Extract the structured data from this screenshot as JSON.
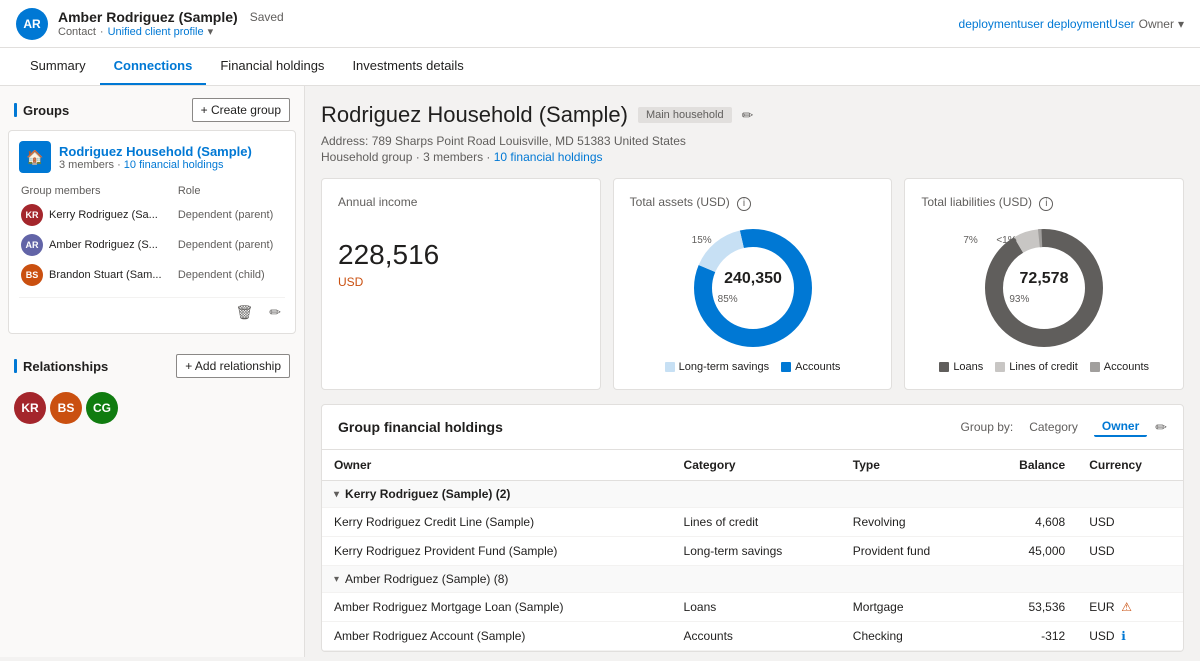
{
  "header": {
    "avatar_initials": "AR",
    "name": "Amber Rodriguez (Sample)",
    "saved_label": "Saved",
    "contact_label": "Contact",
    "profile_label": "Unified client profile",
    "user_label": "deploymentuser deploymentUser",
    "owner_label": "Owner"
  },
  "nav": {
    "tabs": [
      {
        "label": "Summary",
        "active": false
      },
      {
        "label": "Connections",
        "active": true
      },
      {
        "label": "Financial holdings",
        "active": false
      },
      {
        "label": "Investments details",
        "active": false
      }
    ]
  },
  "left_panel": {
    "groups_title": "Groups",
    "create_group_label": "+ Create group",
    "group": {
      "name": "Rodriguez Household (Sample)",
      "meta": "3 members · 10 financial holdings",
      "members_col": "Group members",
      "role_col": "Role",
      "members": [
        {
          "initials": "KR",
          "name": "Kerry Rodriguez (Sa...",
          "role": "Dependent (parent)",
          "color": "#a4262c"
        },
        {
          "initials": "AR",
          "name": "Amber Rodriguez (S...",
          "role": "Dependent (parent)",
          "color": "#6264a7"
        },
        {
          "initials": "BS",
          "name": "Brandon Stuart (Sam...",
          "role": "Dependent (child)",
          "color": "#ca5010"
        }
      ]
    },
    "relationships_title": "Relationships",
    "add_relationship_label": "+ Add relationship",
    "relationship_avatars": [
      {
        "initials": "KR",
        "color": "#a4262c"
      },
      {
        "initials": "BS",
        "color": "#ca5010"
      },
      {
        "initials": "CG",
        "color": "#107c10"
      }
    ]
  },
  "main": {
    "household_title": "Rodriguez Household (Sample)",
    "main_household_badge": "Main household",
    "address": "Address: 789 Sharps Point Road Louisville, MD 51383 United States",
    "household_group": "Household group",
    "members_count": "3 members",
    "financial_holdings_count": "10 financial holdings",
    "annual_income": {
      "title": "Annual income",
      "value": "228,516",
      "currency": "USD"
    },
    "total_assets": {
      "title": "Total assets (USD)",
      "value": "240,350",
      "segments": [
        {
          "label": "Long-term savings",
          "percent": 15,
          "color": "#c7e0f4"
        },
        {
          "label": "Accounts",
          "percent": 85,
          "color": "#0078d4"
        }
      ],
      "legend_long_term": "Long-term savings",
      "legend_accounts": "Accounts",
      "percent_top": "15%",
      "percent_bottom": "85%"
    },
    "total_liabilities": {
      "title": "Total liabilities (USD)",
      "value": "72,578",
      "segments": [
        {
          "label": "Loans",
          "percent": 93,
          "color": "#605e5c"
        },
        {
          "label": "Lines of credit",
          "percent": 7,
          "color": "#c8c6c4"
        },
        {
          "label": "Accounts",
          "percent": 1,
          "color": "#a19f9d"
        }
      ],
      "legend_loans": "Loans",
      "legend_lines": "Lines of credit",
      "legend_accounts": "Accounts",
      "percent_top_left": "7%",
      "percent_top_right": "<1%",
      "percent_bottom": "93%"
    },
    "holdings": {
      "title": "Group financial holdings",
      "groupby_label": "Group by:",
      "category_label": "Category",
      "owner_label": "Owner",
      "columns": [
        "Owner",
        "Category",
        "Type",
        "Balance",
        "Currency"
      ],
      "rows": [
        {
          "type": "owner-group",
          "owner": "Kerry Rodriguez (Sample) (2)",
          "items": [
            {
              "name": "Kerry Rodriguez Credit Line (Sample)",
              "category": "Lines of credit",
              "type": "Revolving",
              "balance": "4,608",
              "currency": "USD",
              "flag": null
            },
            {
              "name": "Kerry Rodriguez Provident Fund (Sample)",
              "category": "Long-term savings",
              "type": "Provident fund",
              "balance": "45,000",
              "currency": "USD",
              "flag": null
            }
          ]
        },
        {
          "type": "owner-group",
          "owner": "Amber Rodriguez (Sample) (8)",
          "items": [
            {
              "name": "Amber Rodriguez Mortgage Loan (Sample)",
              "category": "Loans",
              "type": "Mortgage",
              "balance": "53,536",
              "currency": "EUR",
              "flag": "warning"
            },
            {
              "name": "Amber Rodriguez Account (Sample)",
              "category": "Accounts",
              "type": "Checking",
              "balance": "-312",
              "currency": "USD",
              "flag": "info"
            }
          ]
        }
      ]
    }
  }
}
